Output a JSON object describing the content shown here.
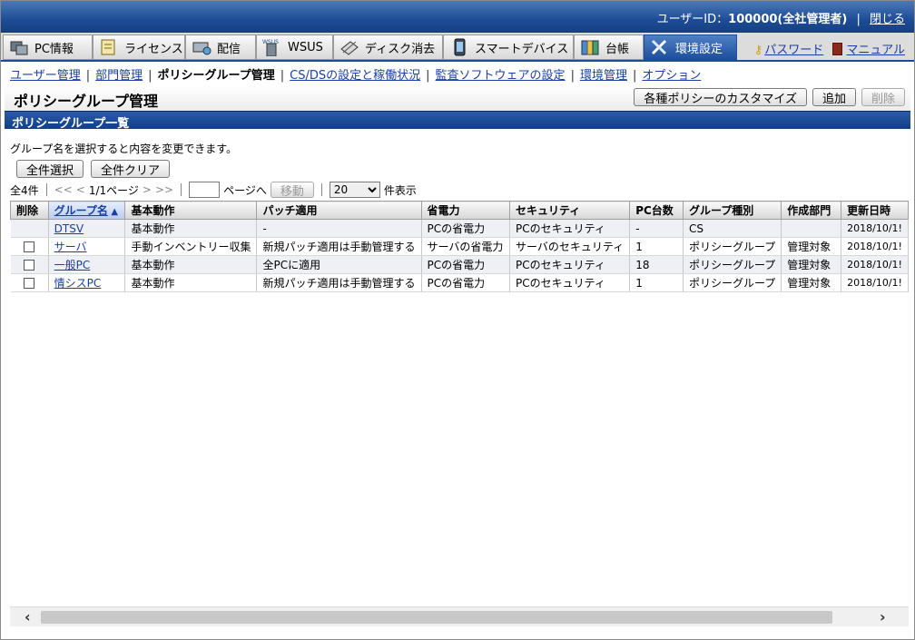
{
  "header": {
    "user_label": "ユーザーID：",
    "user_id": "100000(全社管理者)",
    "close_label": "閉じる"
  },
  "tabs": [
    {
      "label": "PC情報",
      "icon": "pc-info-icon"
    },
    {
      "label": "ライセンス",
      "icon": "license-icon"
    },
    {
      "label": "配信",
      "icon": "distribution-icon"
    },
    {
      "label": "WSUS",
      "icon": "wsus-icon"
    },
    {
      "label": "ディスク消去",
      "icon": "disk-erase-icon"
    },
    {
      "label": "スマートデバイス",
      "icon": "smart-device-icon"
    },
    {
      "label": "台帳",
      "icon": "ledger-icon"
    },
    {
      "label": "環境設定",
      "icon": "settings-icon",
      "active": true
    }
  ],
  "toplinks": {
    "password": "パスワード",
    "manual": "マニュアル"
  },
  "subnav": [
    {
      "label": "ユーザー管理",
      "link": true
    },
    {
      "label": "部門管理",
      "link": true
    },
    {
      "label": "ポリシーグループ管理",
      "link": false
    },
    {
      "label": "CS/DSの設定と稼働状況",
      "link": true
    },
    {
      "label": "監査ソフトウェアの設定",
      "link": true
    },
    {
      "label": "環境管理",
      "link": true
    },
    {
      "label": "オプション",
      "link": true
    }
  ],
  "page": {
    "title": "ポリシーグループ管理",
    "customize_label": "各種ポリシーのカスタマイズ",
    "add_label": "追加",
    "delete_label": "削除",
    "section_title": "ポリシーグループ一覧",
    "description": "グループ名を選択すると内容を変更できます。",
    "select_all": "全件選択",
    "clear_all": "全件クリア"
  },
  "pager": {
    "total": "全4件",
    "first": "<<",
    "prev": "<",
    "page": "1/1ページ",
    "next": ">",
    "last": ">>",
    "goto_suffix": "ページへ",
    "move_label": "移動",
    "per_page": "20",
    "per_page_suffix": "件表示"
  },
  "table": {
    "columns": [
      "削除",
      "グループ名",
      "基本動作",
      "パッチ適用",
      "省電力",
      "セキュリティ",
      "PC台数",
      "グループ種別",
      "作成部門",
      "更新日時"
    ],
    "rows": [
      {
        "checkbox": false,
        "name": "DTSV",
        "basic": "基本動作",
        "patch": "-",
        "power": "PCの省電力",
        "security": "PCのセキュリティ",
        "pcs": "-",
        "type": "CS",
        "dept": "",
        "updated": "2018/10/1!"
      },
      {
        "checkbox": true,
        "name": "サーバ",
        "basic": "手動インベントリー収集",
        "patch": "新規パッチ適用は手動管理する",
        "power": "サーバの省電力",
        "security": "サーバのセキュリティ",
        "pcs": "1",
        "type": "ポリシーグループ",
        "dept": "管理対象",
        "updated": "2018/10/1!"
      },
      {
        "checkbox": true,
        "name": "一般PC",
        "basic": "基本動作",
        "patch": "全PCに適用",
        "power": "PCの省電力",
        "security": "PCのセキュリティ",
        "pcs": "18",
        "type": "ポリシーグループ",
        "dept": "管理対象",
        "updated": "2018/10/1!"
      },
      {
        "checkbox": true,
        "name": "情シスPC",
        "basic": "基本動作",
        "patch": "新規パッチ適用は手動管理する",
        "power": "PCの省電力",
        "security": "PCのセキュリティ",
        "pcs": "1",
        "type": "ポリシーグループ",
        "dept": "管理対象",
        "updated": "2018/10/1!"
      }
    ]
  },
  "colors": {
    "brand": "#1d4c96",
    "link": "#1a3fa8"
  }
}
